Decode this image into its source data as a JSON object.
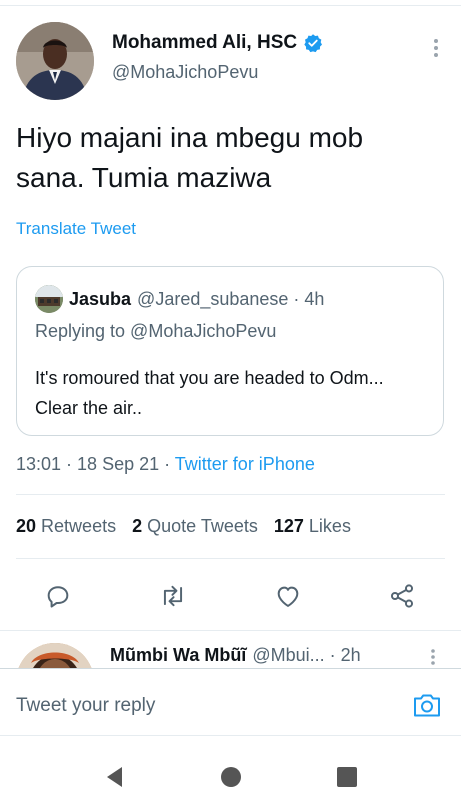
{
  "tweet": {
    "author": {
      "display_name": "Mohammed Ali, HSC",
      "handle": "@MohaJichoPevu",
      "verified": true
    },
    "text_line1": "Hiyo majani ina mbegu mob",
    "text_line2": "sana. Tumia maziwa",
    "translate_label": "Translate Tweet",
    "quoted": {
      "name": "Jasuba",
      "handle": "@Jared_subanese",
      "separator": " · ",
      "time": "4h",
      "replying_to": "Replying to @MohaJichoPevu",
      "text": "It's romoured that you are headed to Odm... Clear the air.."
    },
    "meta": {
      "time": "13:01",
      "separator1": " · ",
      "date": "18 Sep 21",
      "separator2": " · ",
      "source": "Twitter for iPhone"
    },
    "stats": {
      "retweets_count": "20",
      "retweets_label": "Retweets",
      "quote_count": "2",
      "quote_label": "Quote Tweets",
      "likes_count": "127",
      "likes_label": "Likes"
    }
  },
  "reply_preview": {
    "name": "Mũmbi Wa Mbũĩ",
    "handle": "@Mbui...",
    "separator": " · ",
    "time": "2h"
  },
  "composer": {
    "placeholder": "Tweet your reply"
  },
  "icons": {
    "reply": "reply-icon",
    "retweet": "retweet-icon",
    "like": "heart-icon",
    "share": "share-icon",
    "camera": "camera-icon",
    "more": "more-vertical-icon",
    "verified": "verified-badge-icon",
    "nav_back": "back-triangle-icon",
    "nav_home": "home-circle-icon",
    "nav_recents": "recents-square-icon"
  },
  "colors": {
    "accent": "#1d9bf0",
    "text_primary": "#0f1419",
    "text_secondary": "#536471",
    "border": "#cfd9de"
  }
}
